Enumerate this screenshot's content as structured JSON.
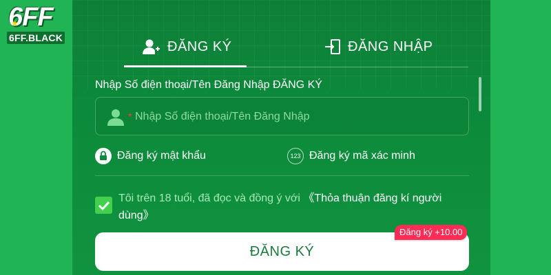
{
  "brand": {
    "logo_text": "6FF",
    "logo_domain": "6FF.BLACK"
  },
  "tabs": [
    {
      "label": "ĐĂNG KÝ",
      "icon": "add-user-icon",
      "active": true
    },
    {
      "label": "ĐĂNG NHẬP",
      "icon": "login-door-icon",
      "active": false
    }
  ],
  "form": {
    "field_label": "Nhập Số điện thoại/Tên Đăng Nhập ĐĂNG KÝ",
    "required_mark": "*",
    "input_placeholder": "Nhập Số điện thoại/Tên Đăng Nhập",
    "input_value": ""
  },
  "options": {
    "password_label": "Đăng ký mật khẩu",
    "code_badge": "123",
    "code_label": "Đăng ký mã xác minh"
  },
  "agreement": {
    "checked": true,
    "text": "Tôi trên 18 tuổi, đã đọc và đồng ý với ",
    "link": "《Thỏa thuận đăng kí người dùng》"
  },
  "submit": {
    "label": "ĐĂNG KÝ",
    "bonus": "Đăng ký +10.00"
  },
  "colors": {
    "background": "#1fb151",
    "panel": "#0e7f37",
    "accent_badge": "#ff2d55",
    "checkbox": "#43d14d",
    "button_text": "#1a7a3c"
  }
}
